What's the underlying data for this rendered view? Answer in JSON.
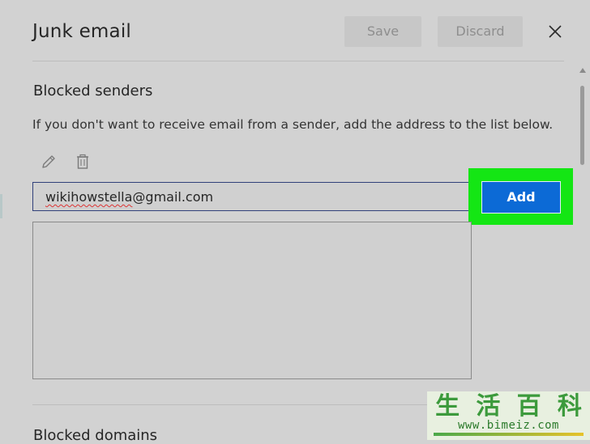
{
  "dialog": {
    "title": "Junk email",
    "save_label": "Save",
    "discard_label": "Discard"
  },
  "blocked_senders": {
    "title": "Blocked senders",
    "description": "If you don't want to receive email from a sender, add the address to the list below.",
    "input_value_misspelled": "wikihowstella",
    "input_value_rest": "@gmail.com",
    "add_label": "Add",
    "entries": []
  },
  "blocked_domains": {
    "title": "Blocked domains"
  },
  "watermark": {
    "chars": [
      "生",
      "活",
      "百",
      "科"
    ],
    "url": "www.bimeiz.com"
  },
  "colors": {
    "background": "#d2d2d2",
    "add_button": "#0c6ad6",
    "highlight": "#14e614",
    "input_border": "#30407a"
  },
  "icons": {
    "edit": "pencil-icon",
    "delete": "trash-icon",
    "close": "close-icon"
  }
}
